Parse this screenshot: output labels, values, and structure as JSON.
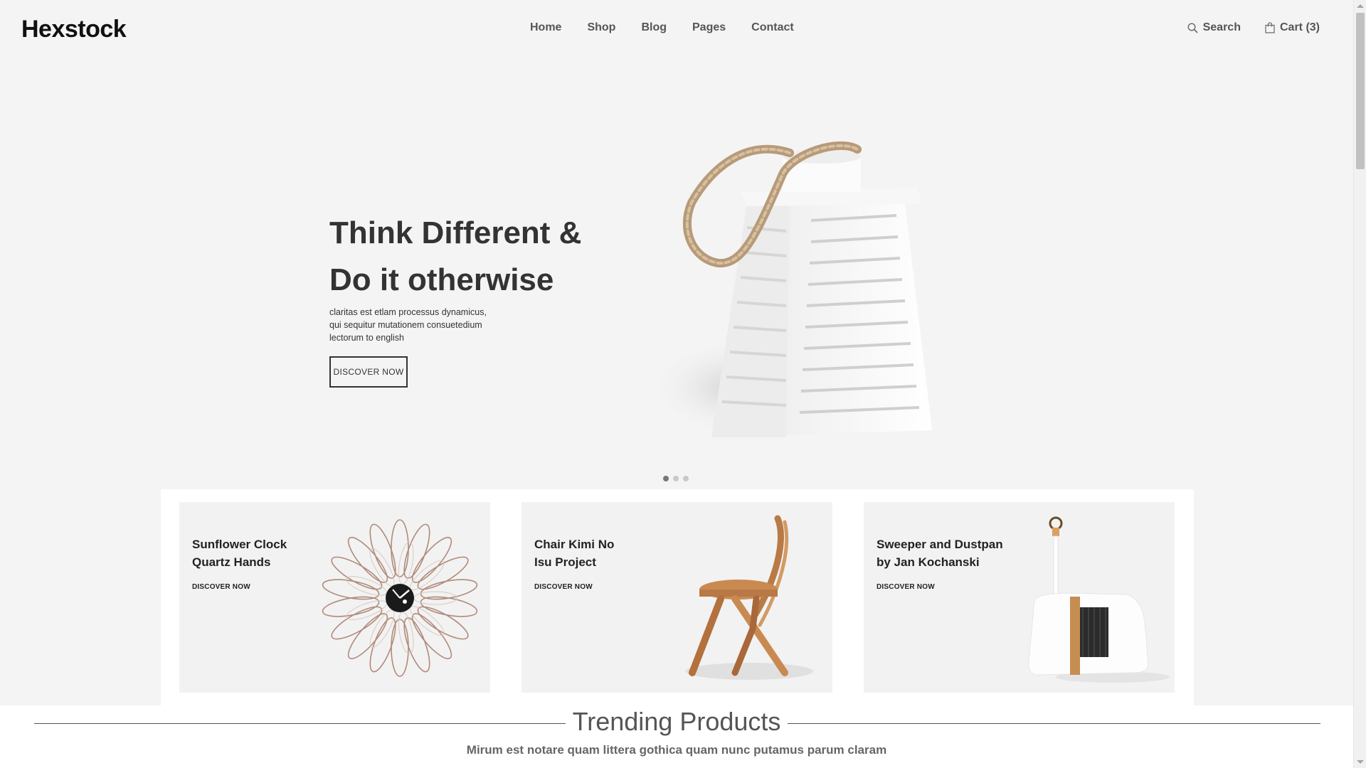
{
  "header": {
    "logo": "Hexstock",
    "nav": [
      "Home",
      "Shop",
      "Blog",
      "Pages",
      "Contact"
    ],
    "search_label": "Search",
    "cart_label": "Cart (3)"
  },
  "hero": {
    "title_line1": "Think Different &",
    "title_line2": "Do it otherwise",
    "text_line1": "claritas est etlam processus dynamicus,",
    "text_line2": "qui sequitur mutationem consuetedium",
    "text_line3": "lectorum to english",
    "button": "DISCOVER NOW",
    "slides_total": 3,
    "active_slide": 1
  },
  "banners": [
    {
      "title_line1": "Sunflower Clock",
      "title_line2": "Quartz Hands",
      "link": "DISCOVER NOW"
    },
    {
      "title_line1": "Chair Kimi No",
      "title_line2": "Isu Project",
      "link": "DISCOVER NOW"
    },
    {
      "title_line1": "Sweeper and Dustpan",
      "title_line2": "by Jan Kochanski",
      "link": "DISCOVER NOW"
    }
  ],
  "trending": {
    "title": "Trending Products",
    "subtitle": "Mirum est notare quam littera gothica quam nunc putamus parum claram"
  },
  "colors": {
    "background": "#f4f4f4",
    "text": "#333333",
    "card": "#f2f2f2"
  }
}
